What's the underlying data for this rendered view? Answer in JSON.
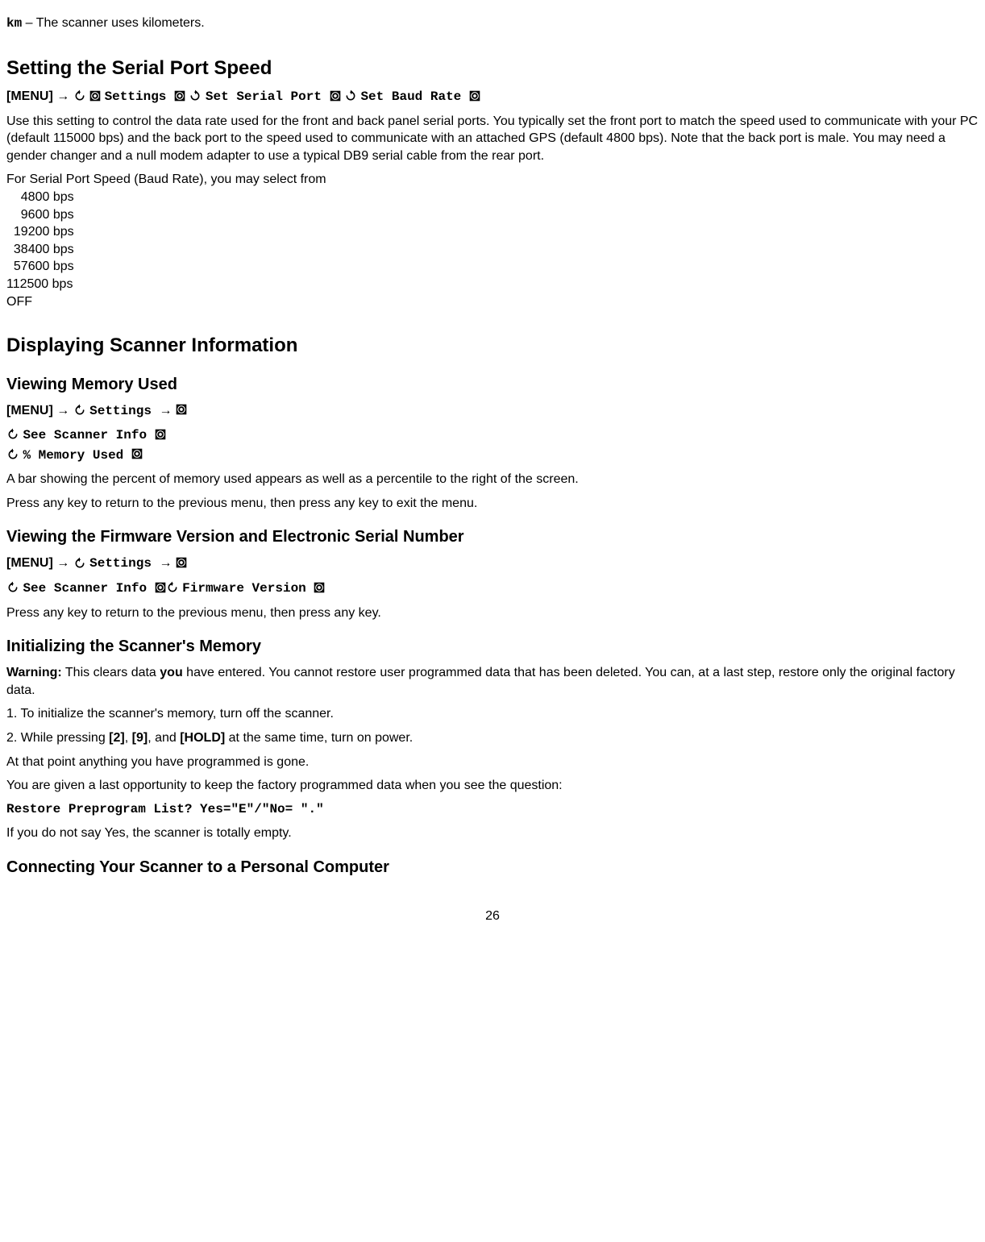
{
  "top": {
    "km_code": "km",
    "km_desc": " – The scanner uses kilometers."
  },
  "h_serial": "Setting the Serial Port Speed",
  "serial_path": {
    "menu": "[MENU]",
    "settings": "Settings",
    "set_serial": "Set Serial Port",
    "set_baud": "Set Baud Rate"
  },
  "serial_para": "Use this setting to control the data rate used for the front and back panel serial ports. You typically set the front port to match the speed used to communicate with your PC (default 115000 bps) and the back port to the speed used to communicate with an attached GPS (default 4800 bps). Note that the back port is male. You may need a gender changer and a null modem adapter to use a typical DB9 serial cable from the rear port.",
  "baud_intro": "For Serial Port Speed (Baud Rate), you may select from",
  "baud_lines": [
    "    4800 bps",
    "    9600 bps",
    "  19200 bps",
    "  38400 bps",
    "  57600 bps",
    "112500 bps",
    "OFF"
  ],
  "h_display": "Displaying Scanner Information",
  "h_mem": "Viewing Memory Used",
  "mem_path1": {
    "menu": " [MENU]",
    "settings": "Settings"
  },
  "mem_line2": "See Scanner Info",
  "mem_line3": "  % Memory Used",
  "mem_para1": "A bar showing the percent of memory used appears as well as a percentile to the right of the screen.",
  "mem_para2": "Press any key to return to the previous menu, then press any key to exit the menu.",
  "h_fw": "Viewing the Firmware Version and Electronic Serial Number",
  "fw_path1": {
    "menu": "[MENU]",
    "settings": "Settings"
  },
  "fw_line2_a": "See Scanner Info",
  "fw_line2_b": " Firmware Version",
  "fw_para": "Press any key to return to the previous menu, then press any key.",
  "h_init": "Initializing the Scanner's Memory",
  "init_warn_label": "Warning:",
  "init_warn_a": " This clears data ",
  "init_warn_you": "you",
  "init_warn_b": " have entered. You cannot restore user programmed data that has been deleted. You can, at a last step, restore only the original factory data.",
  "init_step1": "1. To initialize the scanner's memory, turn off the scanner.",
  "init_step2_a": "2. While pressing ",
  "init_step2_k2": "[2]",
  "init_step2_c1": ", ",
  "init_step2_k9": "[9]",
  "init_step2_c2": ", and ",
  "init_step2_khold": "[HOLD]",
  "init_step2_b": " at the same time, turn on power.",
  "init_p3": "At that point anything you have programmed is gone.",
  "init_p4": "You are given a last opportunity to keep the factory programmed data when you see the question:",
  "init_restore": "Restore Preprogram List? Yes=\"E\"/\"No= \".\"",
  "init_p5": "If you do not say Yes, the scanner is totally empty.",
  "h_connect": "Connecting Your Scanner to a Personal Computer",
  "page_num": "26",
  "arrow": " → "
}
